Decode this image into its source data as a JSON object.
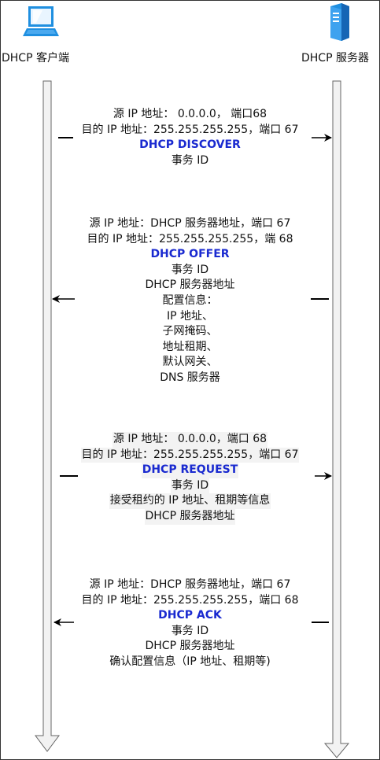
{
  "actors": {
    "client": {
      "label": "DHCP 客户端",
      "icon": "laptop-icon"
    },
    "server": {
      "label": "DHCP 服务器",
      "icon": "server-icon"
    }
  },
  "colors": {
    "message_title": "#1a2ad0",
    "lifeline_fill": "#f2f2f2",
    "lifeline_stroke": "#666666",
    "icon_blue": "#1f8fe0"
  },
  "messages": [
    {
      "id": "discover",
      "direction": "client-to-server",
      "lines": [
        "源 IP 地址： 0.0.0.0， 端口68",
        "目的 IP 地址：255.255.255.255，端口 67"
      ],
      "title": "DHCP DISCOVER",
      "extra": [
        "事务 ID"
      ]
    },
    {
      "id": "offer",
      "direction": "server-to-client",
      "lines": [
        "源 IP 地址：DHCP 服务器地址，端口 67",
        "目的 IP 地址：255.255.255.255，端 68"
      ],
      "title": "DHCP OFFER",
      "extra": [
        "事务 ID",
        "DHCP 服务器地址",
        "配置信息：",
        "IP 地址、",
        "子网掩码、",
        "地址租期、",
        "默认网关、",
        "DNS 服务器"
      ]
    },
    {
      "id": "request",
      "direction": "client-to-server",
      "lines": [
        "源 IP 地址： 0.0.0.0，端口 68",
        "目的 IP 地址：255.255.255.255，端口 67"
      ],
      "title": "DHCP REQUEST",
      "extra": [
        "事务 ID",
        "接受租约的 IP 地址、租期等信息",
        "DHCP 服务器地址"
      ]
    },
    {
      "id": "ack",
      "direction": "server-to-client",
      "lines": [
        "源 IP 地址：DHCP 服务器地址，端口 67",
        "目的 IP 地址：255.255.255.255，端口 68"
      ],
      "title": "DHCP ACK",
      "extra": [
        "事务 ID",
        "DHCP 服务器地址",
        "确认配置信息（IP 地址、租期等)"
      ]
    }
  ]
}
